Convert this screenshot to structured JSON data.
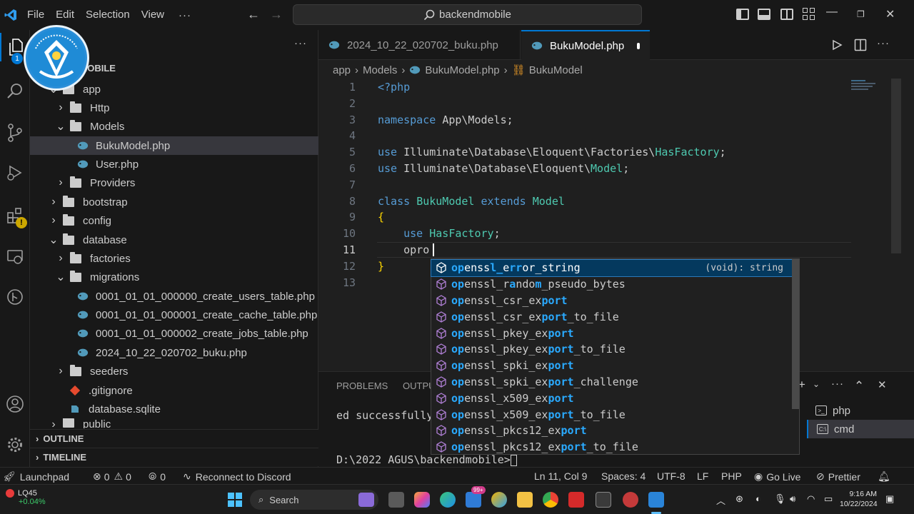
{
  "titlebar": {
    "menu": [
      "File",
      "Edit",
      "Selection",
      "View"
    ],
    "more": "···",
    "search_text": "backendmobile"
  },
  "activity": {
    "explorer_badge": "1"
  },
  "sidebar": {
    "more": "···",
    "root_label": "DMOBILE",
    "tree": [
      {
        "label": "app",
        "kind": "folder",
        "expanded": true
      },
      {
        "label": "Http",
        "kind": "folder",
        "expanded": false
      },
      {
        "label": "Models",
        "kind": "folder",
        "expanded": true
      },
      {
        "label": "BukuModel.php",
        "kind": "php",
        "selected": true
      },
      {
        "label": "User.php",
        "kind": "php"
      },
      {
        "label": "Providers",
        "kind": "folder",
        "expanded": false
      },
      {
        "label": "bootstrap",
        "kind": "folder",
        "expanded": false
      },
      {
        "label": "config",
        "kind": "folder",
        "expanded": false
      },
      {
        "label": "database",
        "kind": "folder",
        "expanded": true
      },
      {
        "label": "factories",
        "kind": "folder",
        "expanded": false
      },
      {
        "label": "migrations",
        "kind": "folder",
        "expanded": true
      },
      {
        "label": "0001_01_01_000000_create_users_table.php",
        "kind": "php"
      },
      {
        "label": "0001_01_01_000001_create_cache_table.php",
        "kind": "php"
      },
      {
        "label": "0001_01_01_000002_create_jobs_table.php",
        "kind": "php"
      },
      {
        "label": "2024_10_22_020702_buku.php",
        "kind": "php"
      },
      {
        "label": "seeders",
        "kind": "folder",
        "expanded": false
      },
      {
        "label": ".gitignore",
        "kind": "git"
      },
      {
        "label": "database.sqlite",
        "kind": "db"
      },
      {
        "label": "public",
        "kind": "folder",
        "expanded": false
      }
    ],
    "outline_label": "OUTLINE",
    "timeline_label": "TIMELINE"
  },
  "tabs": [
    {
      "label": "2024_10_22_020702_buku.php",
      "active": false
    },
    {
      "label": "BukuModel.php",
      "active": true,
      "dirty": true
    }
  ],
  "breadcrumb": [
    "app",
    "Models",
    "BukuModel.php",
    "BukuModel"
  ],
  "editor": {
    "line_numbers": [
      "1",
      "2",
      "3",
      "4",
      "5",
      "6",
      "7",
      "8",
      "9",
      "10",
      "11",
      "12",
      "13"
    ],
    "current_line": "11",
    "lines": [
      [
        {
          "t": "<?php",
          "c": "kw"
        }
      ],
      [],
      [
        {
          "t": "namespace ",
          "c": "kw"
        },
        {
          "t": "App\\Models;",
          "c": ""
        }
      ],
      [],
      [
        {
          "t": "use ",
          "c": "kw"
        },
        {
          "t": "Illuminate\\Database\\Eloquent\\Factories\\",
          "c": ""
        },
        {
          "t": "HasFactory",
          "c": "cls"
        },
        {
          "t": ";",
          "c": ""
        }
      ],
      [
        {
          "t": "use ",
          "c": "kw"
        },
        {
          "t": "Illuminate\\Database\\Eloquent\\",
          "c": ""
        },
        {
          "t": "Model",
          "c": "cls"
        },
        {
          "t": ";",
          "c": ""
        }
      ],
      [],
      [
        {
          "t": "class ",
          "c": "kw"
        },
        {
          "t": "BukuModel ",
          "c": "cls"
        },
        {
          "t": "extends ",
          "c": "kw"
        },
        {
          "t": "Model",
          "c": "cls"
        }
      ],
      [
        {
          "t": "{",
          "c": "br"
        }
      ],
      [
        {
          "t": "    ",
          "c": ""
        },
        {
          "t": "use ",
          "c": "kw"
        },
        {
          "t": "HasFactory",
          "c": "cls"
        },
        {
          "t": ";",
          "c": ""
        }
      ],
      [
        {
          "t": "    opro",
          "c": ""
        }
      ],
      [
        {
          "t": "}",
          "c": "br"
        }
      ],
      []
    ]
  },
  "suggest": {
    "items": [
      {
        "label": "openssl_error_string",
        "detail": "(void): string",
        "focused": true
      },
      {
        "label": "openssl_random_pseudo_bytes"
      },
      {
        "label": "openssl_csr_export"
      },
      {
        "label": "openssl_csr_export_to_file"
      },
      {
        "label": "openssl_pkey_export"
      },
      {
        "label": "openssl_pkey_export_to_file"
      },
      {
        "label": "openssl_spki_export"
      },
      {
        "label": "openssl_spki_export_challenge"
      },
      {
        "label": "openssl_x509_export"
      },
      {
        "label": "openssl_x509_export_to_file"
      },
      {
        "label": "openssl_pkcs12_export"
      },
      {
        "label": "openssl_pkcs12_export_to_file"
      }
    ]
  },
  "panel": {
    "tabs": [
      "PROBLEMS",
      "OUTPU"
    ],
    "terminal_lines": [
      "ed successfully",
      "",
      "D:\\2022 AGUS\\backendmobile>"
    ],
    "terminals": [
      {
        "label": "php",
        "selected": false
      },
      {
        "label": "cmd",
        "selected": true
      }
    ]
  },
  "statusbar": {
    "launchpad": "Launchpad",
    "errors": "0",
    "warnings": "0",
    "ports": "0",
    "discord": "Reconnect to Discord",
    "position": "Ln 11, Col 9",
    "spaces": "Spaces: 4",
    "encoding": "UTF-8",
    "eol": "LF",
    "language": "PHP",
    "golive": "Go Live",
    "prettier": "Prettier"
  },
  "taskbar": {
    "stock_name": "LQ45",
    "stock_change": "+0.04%",
    "search_label": "Search",
    "notif_count": "99+",
    "time": "9:16 AM",
    "date": "10/22/2024"
  },
  "colors": {
    "accent": "#0078d4",
    "keyword": "#569cd6",
    "type": "#4ec9b0",
    "bracket": "#ffd700",
    "php_icon": "#519aba"
  }
}
